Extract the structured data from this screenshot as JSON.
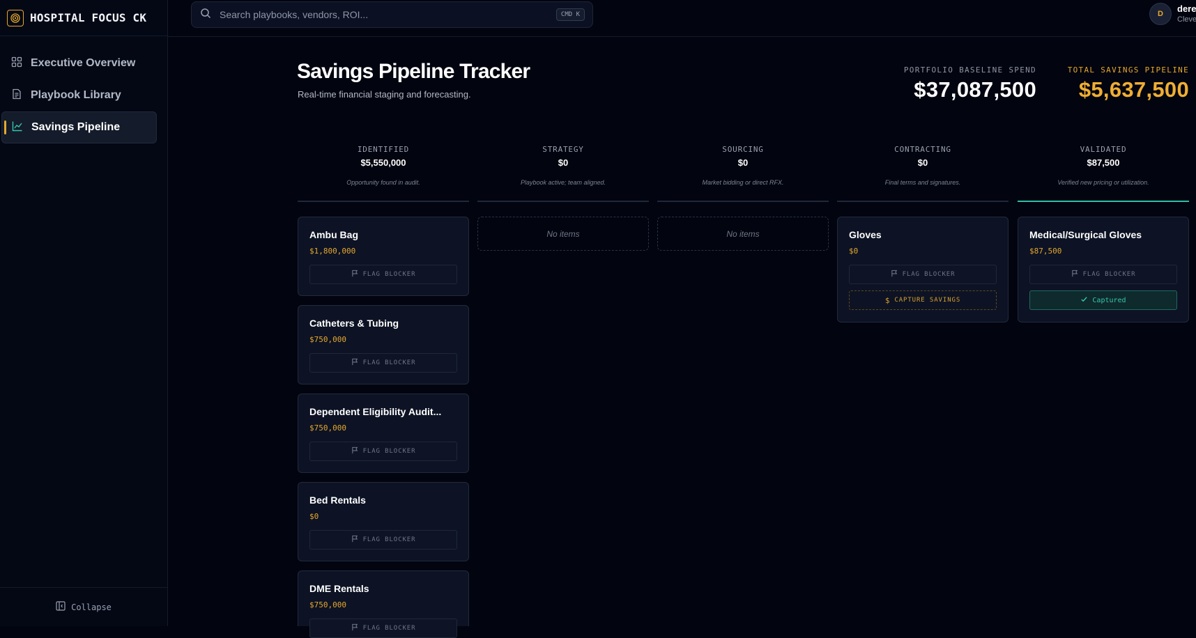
{
  "brand": {
    "name": "HOSPITAL FOCUS CK",
    "accent": "#e6a82e"
  },
  "sidebar": {
    "items": [
      {
        "label": "Executive Overview",
        "icon": "grid-icon",
        "active": false
      },
      {
        "label": "Playbook Library",
        "icon": "document-icon",
        "active": false
      },
      {
        "label": "Savings Pipeline",
        "icon": "line-chart-icon",
        "active": true
      }
    ],
    "collapse_label": "Collapse"
  },
  "search": {
    "placeholder": "Search playbooks, vendors, ROI...",
    "value": "",
    "shortcut": "CMD K"
  },
  "user": {
    "initial": "D",
    "name": "dere",
    "org": "Cleve"
  },
  "header": {
    "title": "Savings Pipeline Tracker",
    "subtitle": "Real-time financial staging and forecasting.",
    "baseline_label": "PORTFOLIO BASELINE SPEND",
    "baseline_value": "$37,087,500",
    "pipeline_label": "TOTAL SAVINGS PIPELINE",
    "pipeline_value": "$5,637,500"
  },
  "stages": [
    {
      "name": "IDENTIFIED",
      "total": "$5,550,000",
      "desc": "Opportunity found in audit."
    },
    {
      "name": "STRATEGY",
      "total": "$0",
      "desc": "Playbook active; team aligned."
    },
    {
      "name": "SOURCING",
      "total": "$0",
      "desc": "Market bidding or direct RFX."
    },
    {
      "name": "CONTRACTING",
      "total": "$0",
      "desc": "Final terms and signatures."
    },
    {
      "name": "VALIDATED",
      "total": "$87,500",
      "desc": "Verified new pricing or utilization."
    }
  ],
  "empty_label": "No items",
  "buttons": {
    "flag_blocker": "FLAG BLOCKER",
    "capture_savings": "CAPTURE SAVINGS",
    "captured": "Captured"
  },
  "cards": {
    "identified": [
      {
        "title": "Ambu Bag",
        "amount": "$1,800,000"
      },
      {
        "title": "Catheters & Tubing",
        "amount": "$750,000"
      },
      {
        "title": "Dependent Eligibility Audit...",
        "amount": "$750,000"
      },
      {
        "title": "Bed Rentals",
        "amount": "$0"
      },
      {
        "title": "DME Rentals",
        "amount": "$750,000"
      }
    ],
    "contracting": [
      {
        "title": "Gloves",
        "amount": "$0"
      }
    ],
    "validated": [
      {
        "title": "Medical/Surgical Gloves",
        "amount": "$87,500"
      }
    ]
  }
}
